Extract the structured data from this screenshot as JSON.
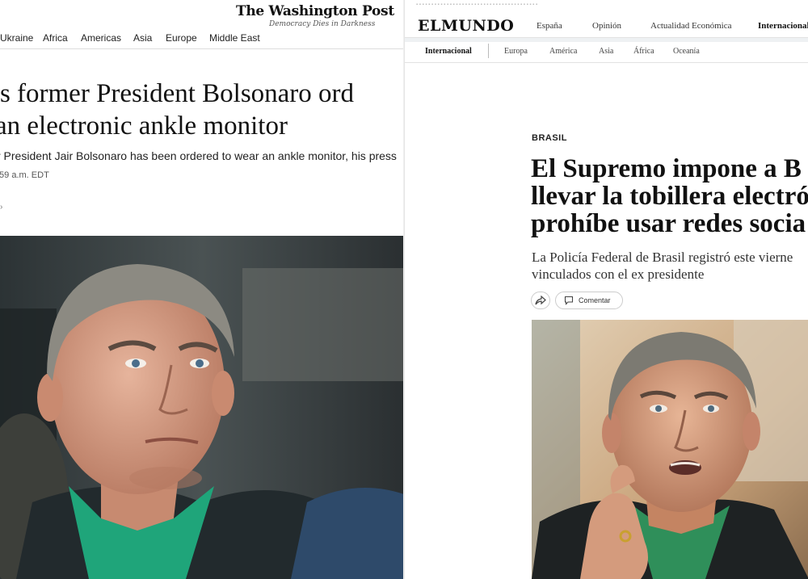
{
  "left_panel": {
    "masthead": "The Washington Post",
    "tagline": "Democracy Dies in Darkness",
    "nav_items": [
      "Ukraine",
      "Africa",
      "Americas",
      "Asia",
      "Europe",
      "Middle East"
    ],
    "headline_line1": "'s former President Bolsonaro ord",
    "headline_line2": "an electronic ankle monitor",
    "dek": "r President Jair Bolsonaro has been ordered to wear an ankle monitor, his press",
    "timestamp": ":59 a.m. EDT",
    "colors": {
      "photo_background": "#3b4448",
      "shirt": "#1fa57a"
    }
  },
  "right_panel": {
    "logo": "ELMUNDO",
    "main_nav": [
      "España",
      "Opinión",
      "Actualidad Económica",
      "Internacional"
    ],
    "active_main_nav": "Internacional",
    "sub_nav": [
      "Internacional",
      "Europa",
      "América",
      "Asia",
      "África",
      "Oceanía"
    ],
    "active_sub_nav": "Internacional",
    "kicker": "BRASIL",
    "headline_line1": "El Supremo impone a B",
    "headline_line2": "llevar la tobillera electró",
    "headline_line3": "prohíbe usar redes socia",
    "dek_line1": "La Policía Federal de Brasil registró este vierne",
    "dek_line2": "vinculados con el ex presidente",
    "share_icon": "share-arrow-icon",
    "comment_label": "Comentar",
    "comment_icon": "speech-bubble-icon",
    "colors": {
      "photo_background": "#c9a37a",
      "shirt": "#2f8f5a"
    }
  }
}
